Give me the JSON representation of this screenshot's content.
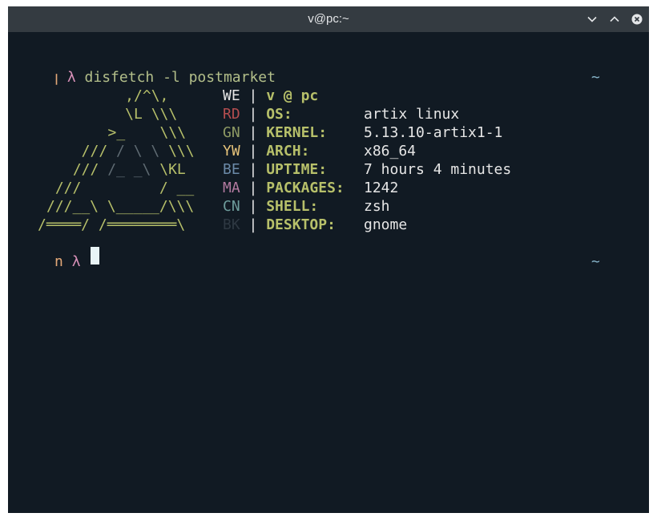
{
  "window": {
    "title": "v@pc:~"
  },
  "titlebar_icons": {
    "minimize": "chevron-down-icon",
    "maximize": "chevron-up-icon",
    "close": "close-icon"
  },
  "prompt": {
    "user_glyph": "ꞁ",
    "user_glyph_second": "n",
    "lambda": "λ",
    "command": "disfetch -l postmarket",
    "tilde": "~"
  },
  "art_lines": [
    "     ,/^\\,",
    "     \\L \\\\\\",
    "   >_    \\\\\\",
    "  ///",
    " ///",
    " ///         / __",
    "///__\\ \\_____/\\\\\\",
    "/════/ /════════\\"
  ],
  "art_dim": [
    "/ \\ \\",
    "/_ _\\"
  ],
  "art_tail": [
    "\\\\\\",
    "\\KL"
  ],
  "info": {
    "header": "v @ pc",
    "rows": [
      {
        "color_code": "WE",
        "key": "",
        "value": ""
      },
      {
        "color_code": "RD",
        "key": "OS:",
        "value": "artix linux"
      },
      {
        "color_code": "GN",
        "key": "KERNEL:",
        "value": "5.13.10-artix1-1"
      },
      {
        "color_code": "YW",
        "key": "ARCH:",
        "value": "x86_64"
      },
      {
        "color_code": "BE",
        "key": "UPTIME:",
        "value": "7 hours 4 minutes"
      },
      {
        "color_code": "MA",
        "key": "PACKAGES:",
        "value": "1242"
      },
      {
        "color_code": "CN",
        "key": "SHELL:",
        "value": "zsh"
      },
      {
        "color_code": "BK",
        "key": "DESKTOP:",
        "value": "gnome"
      }
    ]
  },
  "colors": {
    "background": "#111a23",
    "titlebar": "#343b41",
    "accent": "#b7c06a"
  }
}
